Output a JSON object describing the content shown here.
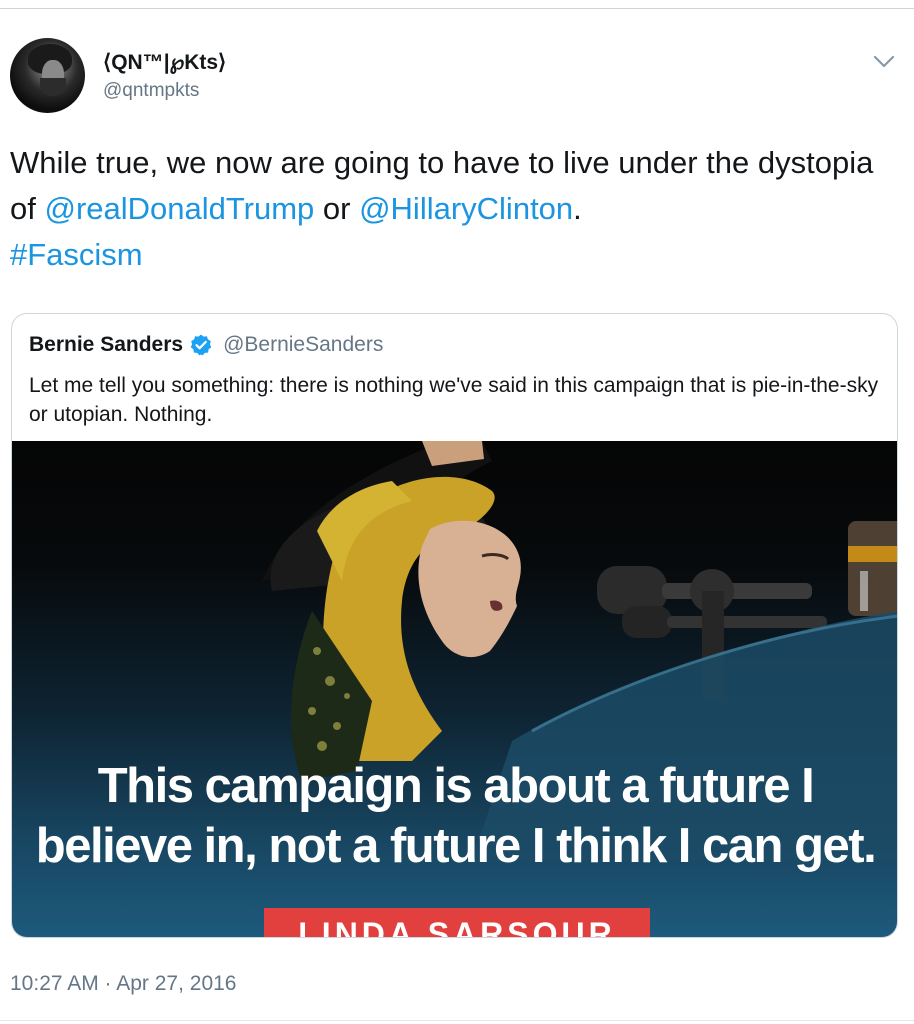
{
  "author": {
    "display_name": "⟨QN™|℘Kts⟩",
    "handle": "@qntmpkts"
  },
  "tweet": {
    "text_1": "While true, we now are going to have to live under the dystopia of ",
    "mention_1": "@realDonaldTrump",
    "text_2": " or ",
    "mention_2": "@HillaryClinton",
    "text_3": ".",
    "hashtag": "#Fascism",
    "timestamp": "10:27 AM · Apr 27, 2016"
  },
  "quoted_tweet": {
    "name": "Bernie Sanders",
    "handle": "@BernieSanders",
    "text": "Let me tell you something: there is nothing we've said in this campaign that is pie-in-the-sky or utopian. Nothing.",
    "media": {
      "caption_line_1": "This campaign is about a future I",
      "caption_line_2": "believe in, not a future I think I can get.",
      "name_tag": "LINDA SARSOUR"
    }
  },
  "icons": {
    "avatar": "avatar-photo",
    "menu": "chevron-down-icon",
    "verified": "verified-badge-icon"
  },
  "colors": {
    "link": "#1b95e0",
    "secondary_text": "#657786",
    "verified": "#1da1f2",
    "name_tag": "#e2403f"
  }
}
